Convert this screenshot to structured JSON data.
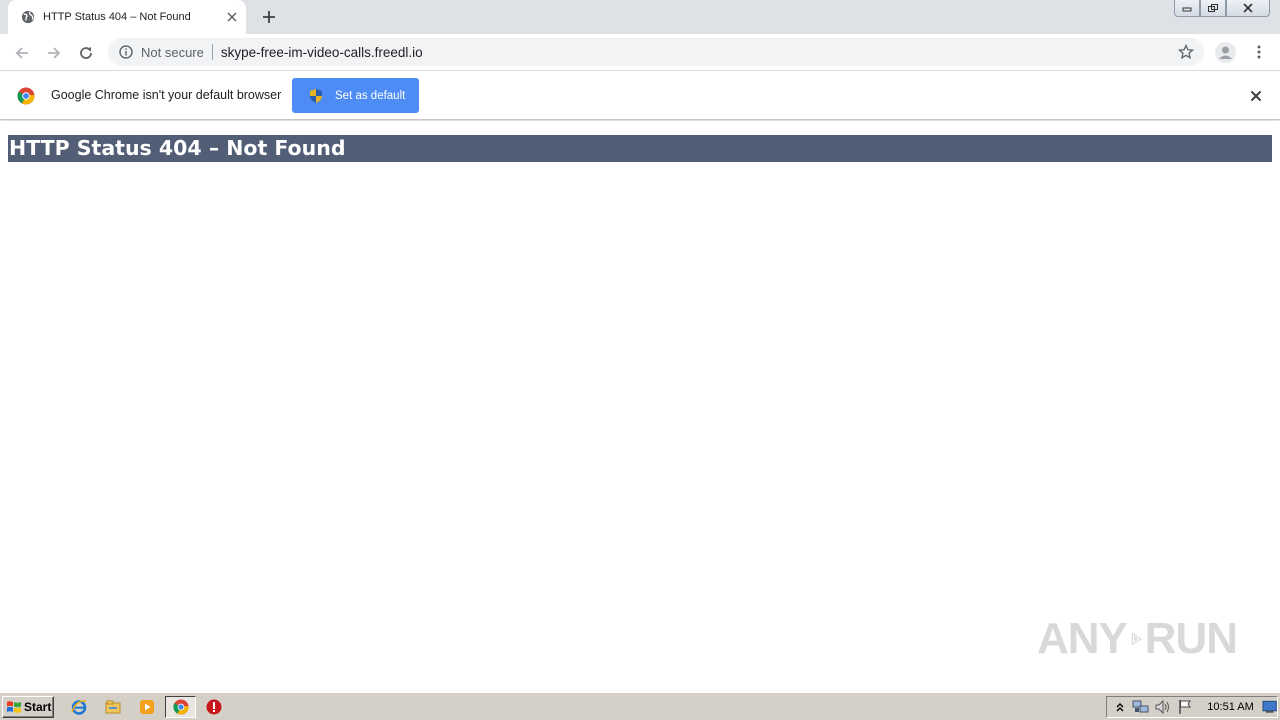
{
  "browser": {
    "tab": {
      "title": "HTTP Status 404 – Not Found",
      "favicon": "globe-icon"
    },
    "omnibox": {
      "security_label": "Not secure",
      "url": "skype-free-im-video-calls.freedl.io"
    }
  },
  "infobar": {
    "message": "Google Chrome isn't your default browser",
    "button_label": "Set as default"
  },
  "page": {
    "heading": "HTTP Status 404 – Not Found"
  },
  "watermark": {
    "left": "ANY",
    "right": "RUN"
  },
  "taskbar": {
    "start_label": "Start",
    "clock": "10:51 AM"
  },
  "colors": {
    "heading_bg": "#525d76",
    "button_bg": "#4d8cf5",
    "tabstrip_bg": "#dee1e6",
    "taskbar_bg": "#d4d0c8"
  }
}
